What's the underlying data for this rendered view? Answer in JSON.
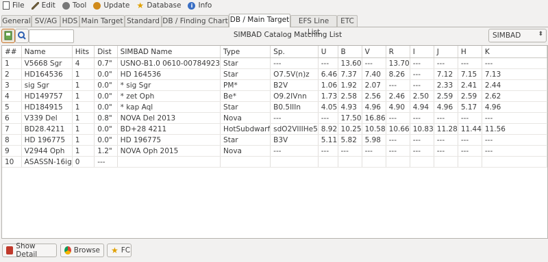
{
  "menu": [
    {
      "icon": "file-icon",
      "label": "File"
    },
    {
      "icon": "edit-icon",
      "label": "Edit"
    },
    {
      "icon": "tool-icon",
      "label": "Tool"
    },
    {
      "icon": "update-icon",
      "label": "Update"
    },
    {
      "icon": "database-icon",
      "label": "Database"
    },
    {
      "icon": "info-icon",
      "label": "Info"
    }
  ],
  "tabs": [
    "General",
    "SV/AG",
    "HDS",
    "Main Target",
    "Standard",
    "DB / Finding Chart",
    "DB / Main Target",
    "EFS Line List",
    "ETC"
  ],
  "active_tab": "DB / Main Target",
  "toolbar": {
    "title": "SIMBAD Catalog Matching List",
    "search_value": "",
    "catalog_select": "SIMBAD"
  },
  "table": {
    "columns": [
      "##",
      "Name",
      "Hits",
      "Dist",
      "SIMBAD Name",
      "Type",
      "Sp.",
      "U",
      "B",
      "V",
      "R",
      "I",
      "J",
      "H",
      "K"
    ],
    "rows": [
      [
        "1",
        "V5668 Sgr",
        "4",
        "0.7\"",
        "USNO-B1.0 0610-00784923",
        "Star",
        "---",
        "---",
        "13.60",
        "---",
        "13.70",
        "---",
        "---",
        "---",
        "---"
      ],
      [
        "2",
        "HD164536",
        "1",
        "0.0\"",
        "HD 164536",
        "Star",
        "O7.5V(n)z",
        "6.46",
        "7.37",
        "7.40",
        "8.26",
        "---",
        "7.12",
        "7.15",
        "7.13"
      ],
      [
        "3",
        "sig Sgr",
        "1",
        "0.0\"",
        "* sig Sgr",
        "PM*",
        "B2V",
        "1.06",
        "1.92",
        "2.07",
        "---",
        "---",
        "2.33",
        "2.41",
        "2.44"
      ],
      [
        "4",
        "HD149757",
        "1",
        "0.0\"",
        "* zet Oph",
        "Be*",
        "O9.2IVnn",
        "1.73",
        "2.58",
        "2.56",
        "2.46",
        "2.50",
        "2.59",
        "2.59",
        "2.62"
      ],
      [
        "5",
        "HD184915",
        "1",
        "0.0\"",
        "* kap Aql",
        "Star",
        "B0.5IIIn",
        "4.05",
        "4.93",
        "4.96",
        "4.90",
        "4.94",
        "4.96",
        "5.17",
        "4.96"
      ],
      [
        "6",
        "V339 Del",
        "1",
        "0.8\"",
        "NOVA Del 2013",
        "Nova",
        "---",
        "---",
        "17.50",
        "16.86",
        "---",
        "---",
        "---",
        "---",
        "---"
      ],
      [
        "7",
        "BD28.4211",
        "1",
        "0.0\"",
        "BD+28 4211",
        "HotSubdwarf",
        "sdO2VIIIHe5",
        "8.92",
        "10.25",
        "10.58",
        "10.66",
        "10.83",
        "11.28",
        "11.44",
        "11.56"
      ],
      [
        "8",
        "HD 196775",
        "1",
        "0.0\"",
        "HD 196775",
        "Star",
        "B3V",
        "5.11",
        "5.82",
        "5.98",
        "---",
        "---",
        "---",
        "---",
        "---"
      ],
      [
        "9",
        "V2944 Oph",
        "1",
        "1.2\"",
        "NOVA Oph 2015",
        "Nova",
        "---",
        "---",
        "---",
        "---",
        "---",
        "---",
        "---",
        "---",
        "---"
      ],
      [
        "10",
        "ASASSN-16ig",
        "0",
        "---",
        "",
        "",
        "",
        "",
        "",
        "",
        "",
        "",
        "",
        "",
        ""
      ]
    ]
  },
  "bottom_buttons": [
    {
      "icon": "detail-icon",
      "label": "Show Detail"
    },
    {
      "icon": "browser-icon",
      "label": "Browse"
    },
    {
      "icon": "star-icon",
      "label": "FC"
    }
  ]
}
